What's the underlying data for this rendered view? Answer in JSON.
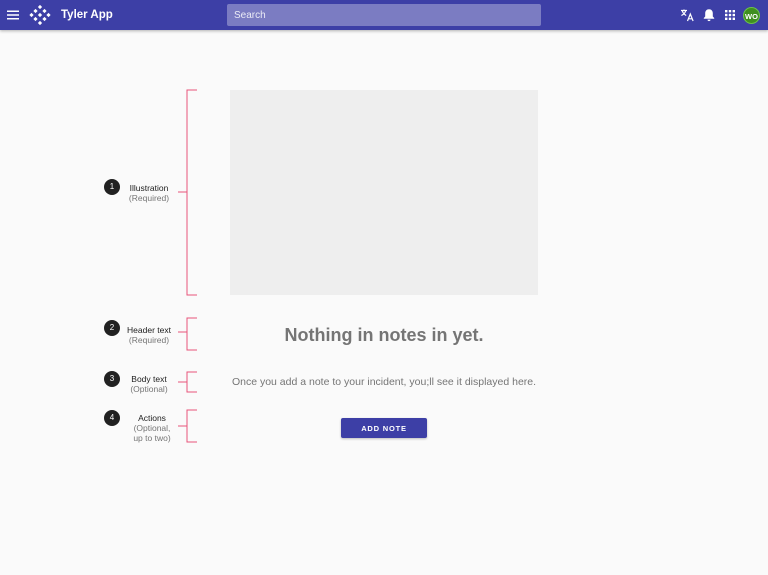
{
  "app": {
    "title": "Tyler App",
    "avatar_initials": "WO",
    "brand_color": "#3d3fa6",
    "avatar_color": "#3f8f1f"
  },
  "search": {
    "placeholder": "Search",
    "value": ""
  },
  "toolbar": {
    "icons": [
      "menu-icon",
      "translate-icon",
      "notifications-bell-icon",
      "apps-grid-icon"
    ]
  },
  "annotations": [
    {
      "number": "1",
      "title": "Illustration",
      "note": "(Required)"
    },
    {
      "number": "2",
      "title": "Header text",
      "note": "(Required)"
    },
    {
      "number": "3",
      "title": "Body text",
      "note": "(Optional)"
    },
    {
      "number": "4",
      "title": "Actions",
      "note_line1": "(Optional,",
      "note_line2": "up to two)"
    }
  ],
  "annotation_color": "#e8547a",
  "empty_state": {
    "header": "Nothing in notes in yet.",
    "body": "Once you add a note to your incident, you;ll see it displayed here.",
    "action_label": "ADD NOTE"
  }
}
